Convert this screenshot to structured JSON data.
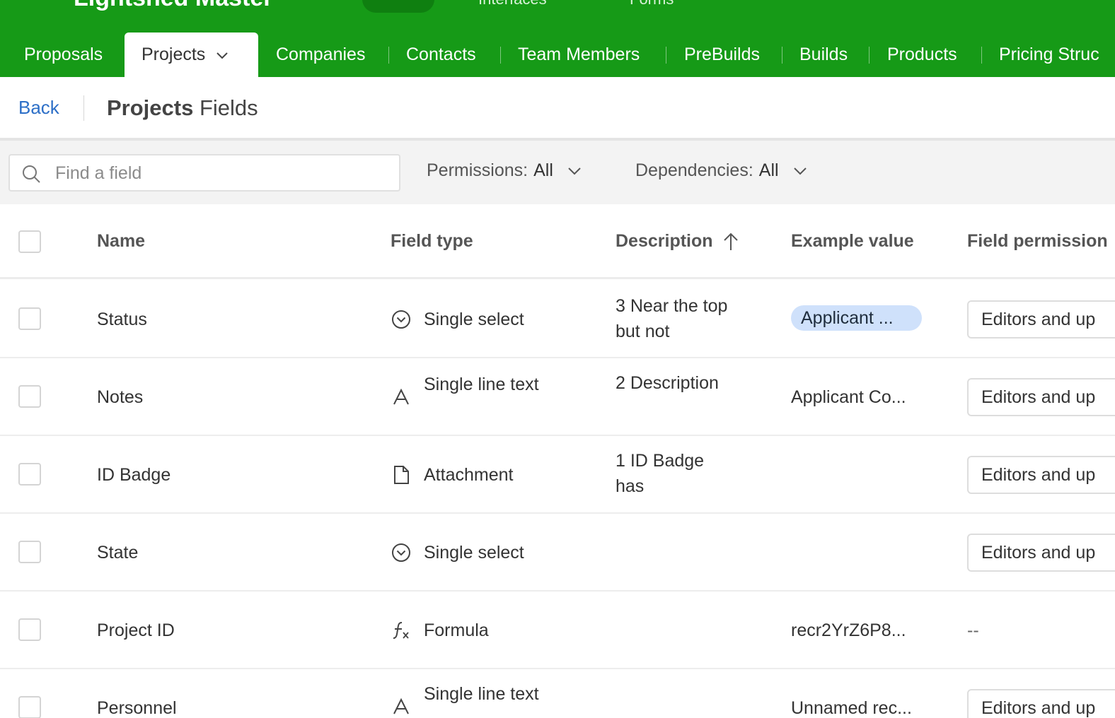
{
  "header": {
    "base_name": "Lightshed Master",
    "nav_ghost": [
      "Interfaces",
      "Forms"
    ]
  },
  "tabs": [
    {
      "label": "Proposals"
    },
    {
      "label": "Projects"
    },
    {
      "label": "Companies"
    },
    {
      "label": "Contacts"
    },
    {
      "label": "Team Members"
    },
    {
      "label": "PreBuilds"
    },
    {
      "label": "Builds"
    },
    {
      "label": "Products"
    },
    {
      "label": "Pricing Struc"
    }
  ],
  "subheader": {
    "back_label": "Back",
    "title_table": "Projects",
    "title_suffix": " Fields"
  },
  "filters": {
    "search_placeholder": "Find a field",
    "permissions_label": "Permissions:",
    "permissions_value": "All",
    "dependencies_label": "Dependencies:",
    "dependencies_value": "All"
  },
  "table": {
    "columns": [
      "Name",
      "Field type",
      "Description",
      "Example value",
      "Field permission"
    ],
    "rows": [
      {
        "name": "Status",
        "type": "Single select",
        "type_icon": "single-select-icon",
        "description": "3 Near the top but not",
        "example": "Applicant ...",
        "example_style": "chip",
        "permission": "Editors and up"
      },
      {
        "name": "Notes",
        "type": "Single line text",
        "type_icon": "text-icon",
        "description": "2 Description",
        "example": "Applicant Co...",
        "permission": "Editors and up"
      },
      {
        "name": "ID Badge",
        "type": "Attachment",
        "type_icon": "attachment-icon",
        "description": "1 ID Badge has",
        "example": "",
        "permission": "Editors and up"
      },
      {
        "name": "State",
        "type": "Single select",
        "type_icon": "single-select-icon",
        "description": "",
        "example": "",
        "permission": "Editors and up"
      },
      {
        "name": "Project ID",
        "type": "Formula",
        "type_icon": "formula-icon",
        "description": "",
        "example": "recr2YrZ6P8...",
        "permission": "--"
      },
      {
        "name": "Personnel",
        "type": "Single line text",
        "type_icon": "text-icon",
        "description": "",
        "example": "Unnamed rec...",
        "permission": "Editors and up"
      }
    ]
  },
  "colors": {
    "brand_green": "#169a17",
    "link_blue": "#2d6fc7",
    "chip_blue": "#cfe1fb"
  }
}
